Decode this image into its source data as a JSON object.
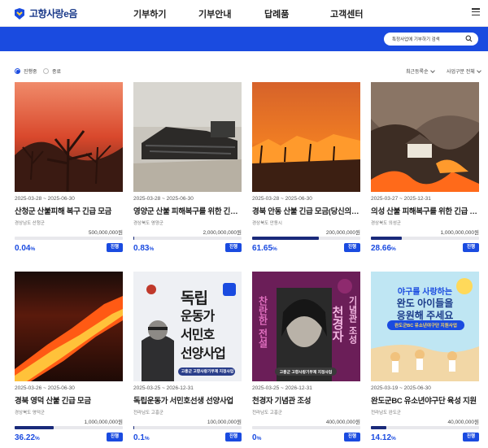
{
  "header": {
    "logo_text": "고향사랑e음",
    "nav": [
      "기부하기",
      "기부안내",
      "답례품",
      "고객센터"
    ],
    "menu_icon": "hamburger-menu-icon"
  },
  "banner": {
    "color": "#1a4be0",
    "search_placeholder": "특정사업에 기부하기 검색"
  },
  "filters": {
    "status_options": [
      {
        "label": "진행중",
        "selected": true
      },
      {
        "label": "종료",
        "selected": false
      }
    ],
    "sort_label": "최근등록순",
    "category_label": "사업구분 전체"
  },
  "cards": [
    {
      "period": "2025-03-28 ~ 2025-06-30",
      "title": "산청군 산불피해 복구 긴급 모금",
      "region": "경상남도 산청군",
      "goal": "500,000,000원",
      "progress": 0.04,
      "pct": "0.04",
      "badge": "진행"
    },
    {
      "period": "2025-03-28 ~ 2025-06-30",
      "title": "영양군 산불 피해복구를 위한 긴급…",
      "region": "경상북도 영양군",
      "goal": "2,000,000,000원",
      "progress": 0.83,
      "pct": "0.83",
      "badge": "진행"
    },
    {
      "period": "2025-03-28 ~ 2025-06-30",
      "title": "경북 안동 산불 긴급 모금(당신의 …",
      "region": "경상북도 안동시",
      "goal": "200,000,000원",
      "progress": 61.65,
      "pct": "61.65",
      "badge": "진행"
    },
    {
      "period": "2025-03-27 ~ 2025-12-31",
      "title": "의성 산불 피해복구를 위한 긴급 …",
      "region": "경상북도 의성군",
      "goal": "1,000,000,000원",
      "progress": 28.66,
      "pct": "28.66",
      "badge": "진행"
    },
    {
      "period": "2025-03-26 ~ 2025-06-30",
      "title": "경북 영덕 산불 긴급 모금",
      "region": "경상북도 영덕군",
      "goal": "1,000,000,000원",
      "progress": 36.22,
      "pct": "36.22",
      "badge": "진행"
    },
    {
      "period": "2025-03-25 ~ 2026-12-31",
      "title": "독립운동가 서민호선생 선양사업",
      "region": "전라남도 고흥군",
      "goal": "100,000,000원",
      "progress": 0.1,
      "pct": "0.1",
      "badge": "진행"
    },
    {
      "period": "2025-03-25 ~ 2026-12-31",
      "title": "천경자 기념관 조성",
      "region": "전라남도 고흥군",
      "goal": "400,000,000원",
      "progress": 0,
      "pct": "0",
      "badge": "진행"
    },
    {
      "period": "2025-03-19 ~ 2025-06-30",
      "title": "완도군BC 유소년야구단 육성 지원",
      "region": "전라남도 완도군",
      "goal": "40,000,000원",
      "progress": 14.12,
      "pct": "14.12",
      "badge": "진행"
    }
  ],
  "posters": {
    "seo": {
      "lines": [
        "독립",
        "운동가",
        "서민호",
        "선양사업"
      ],
      "caption": "고흥군 고향사랑기부제 지정사업"
    },
    "chun": {
      "left": "찬란한 전설",
      "mid": "천경자",
      "right": "기념관 조성",
      "caption": "고흥군 고향사랑기부제 지정사업"
    },
    "wando": {
      "line1": "야구를 사랑하는",
      "line2": "완도 아이들을",
      "line3": "응원해 주세요",
      "caption": "완도군BC 유소년야구단 지원사업"
    }
  }
}
